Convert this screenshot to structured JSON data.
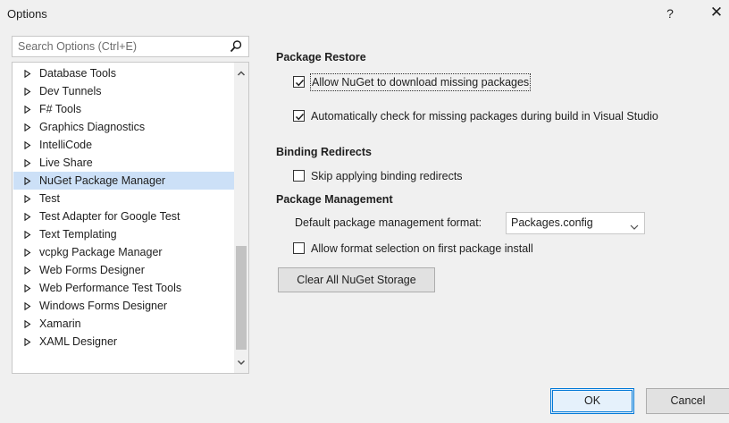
{
  "window": {
    "title": "Options",
    "help_label": "?",
    "close_label": "✕"
  },
  "search": {
    "placeholder": "Search Options (Ctrl+E)"
  },
  "tree": {
    "items": [
      {
        "label": "Database Tools"
      },
      {
        "label": "Dev Tunnels"
      },
      {
        "label": "F# Tools"
      },
      {
        "label": "Graphics Diagnostics"
      },
      {
        "label": "IntelliCode"
      },
      {
        "label": "Live Share"
      },
      {
        "label": "NuGet Package Manager",
        "selected": true
      },
      {
        "label": "Test"
      },
      {
        "label": "Test Adapter for Google Test"
      },
      {
        "label": "Text Templating"
      },
      {
        "label": "vcpkg Package Manager"
      },
      {
        "label": "Web Forms Designer"
      },
      {
        "label": "Web Performance Test Tools"
      },
      {
        "label": "Windows Forms Designer"
      },
      {
        "label": "Xamarin"
      },
      {
        "label": "XAML Designer"
      }
    ]
  },
  "package_restore": {
    "heading": "Package Restore",
    "allow_download": {
      "label": "Allow NuGet to download missing packages",
      "checked": true
    },
    "auto_check": {
      "label": "Automatically check for missing packages during build in Visual Studio",
      "checked": true
    }
  },
  "binding_redirects": {
    "heading": "Binding Redirects",
    "skip": {
      "label": "Skip applying binding redirects",
      "checked": false
    }
  },
  "package_management": {
    "heading": "Package Management",
    "format_label": "Default package management format:",
    "format_value": "Packages.config",
    "allow_format_selection": {
      "label": "Allow format selection on first package install",
      "checked": false
    }
  },
  "buttons": {
    "clear_storage": "Clear All NuGet Storage",
    "ok": "OK",
    "cancel": "Cancel"
  },
  "colors": {
    "selected_row": "#cce0f7",
    "default_button_border": "#0078d7"
  }
}
